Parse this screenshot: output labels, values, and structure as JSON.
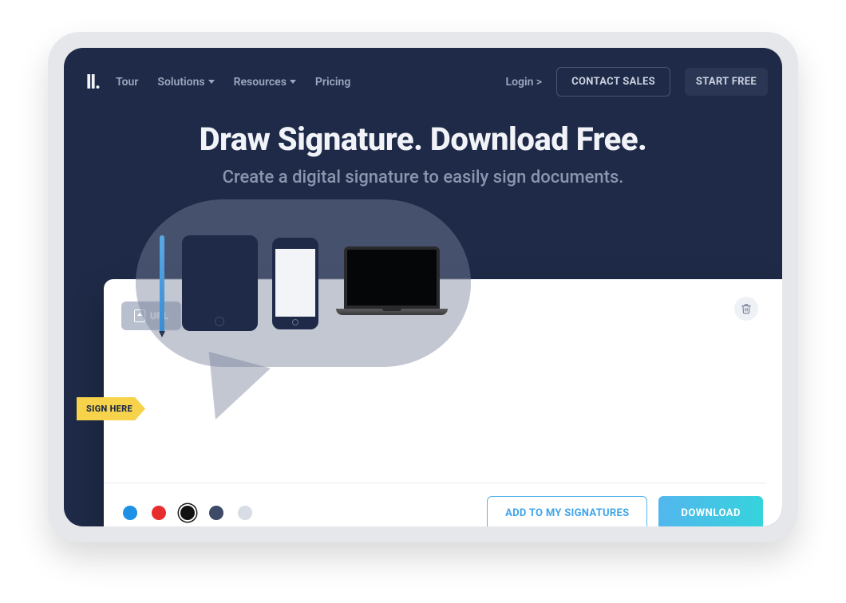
{
  "nav": {
    "logo_fragment": "ll.",
    "links": {
      "tour": "Tour",
      "solutions": "Solutions",
      "resources": "Resources",
      "pricing": "Pricing"
    },
    "login": "Login >",
    "contact_sales": "CONTACT SALES",
    "start_free": "START FREE"
  },
  "hero": {
    "title": "Draw Signature. Download Free.",
    "subtitle": "Create a digital signature to easily sign documents."
  },
  "card": {
    "upload_label": "UPL",
    "sign_here": "SIGN HERE",
    "add_to_signatures": "ADD TO MY SIGNATURES",
    "download": "DOWNLOAD"
  },
  "colors": {
    "blue": "#1E90E6",
    "red": "#E62E2E",
    "black": "#111111",
    "navy": "#3D4A68",
    "gray": "#D7DCE5",
    "selected": "black"
  }
}
